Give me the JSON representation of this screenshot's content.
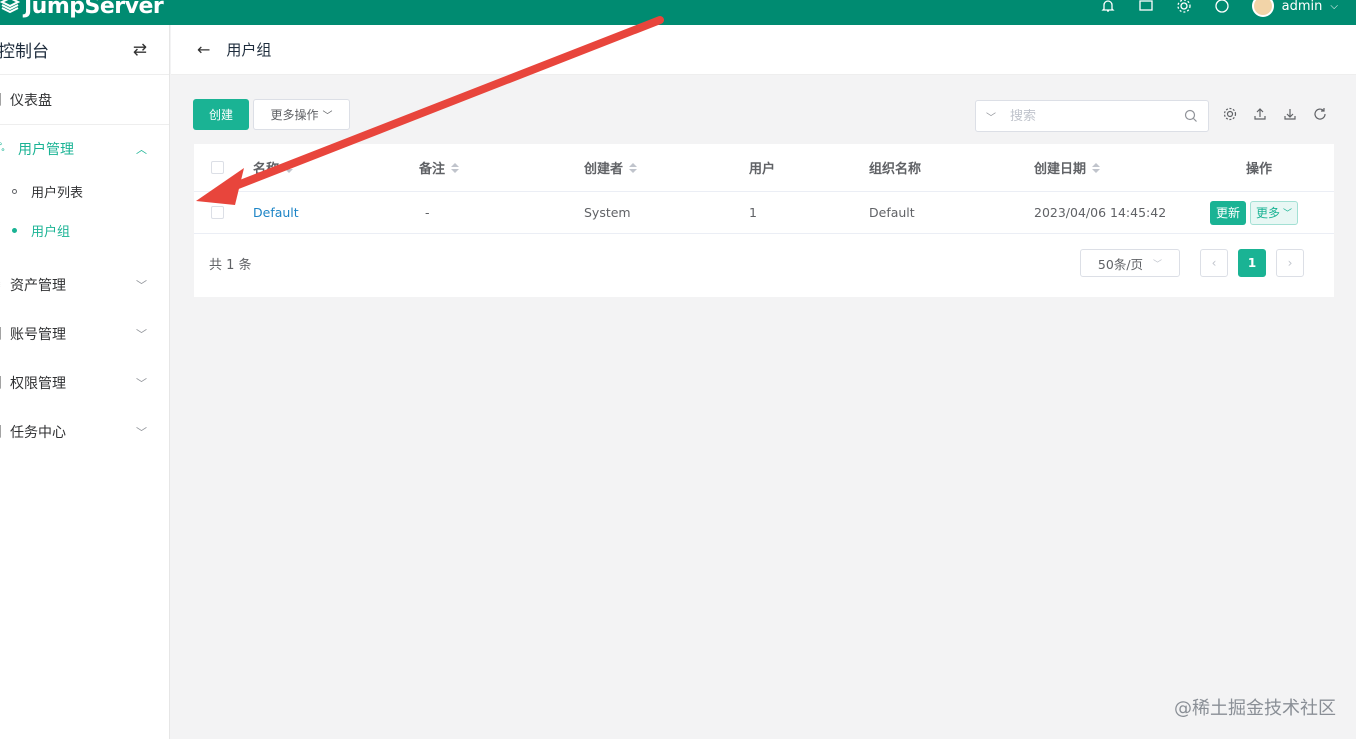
{
  "app": {
    "logo_text": "JumpServer",
    "user": "admin"
  },
  "sidebar": {
    "title": "控制台",
    "items": [
      {
        "label": "仪表盘"
      },
      {
        "label": "用户管理"
      },
      {
        "label": "资产管理"
      },
      {
        "label": "账号管理"
      },
      {
        "label": "权限管理"
      },
      {
        "label": "任务中心"
      }
    ],
    "sub_items": [
      {
        "label": "用户列表"
      },
      {
        "label": "用户组"
      }
    ]
  },
  "header": {
    "title": "用户组"
  },
  "toolbar": {
    "create_label": "创建",
    "more_label": "更多操作",
    "search_placeholder": "搜索"
  },
  "table": {
    "columns": [
      "名称",
      "备注",
      "创建者",
      "用户",
      "组织名称",
      "创建日期",
      "操作"
    ],
    "rows": [
      {
        "name": "Default",
        "comment": "-",
        "creator": "System",
        "users": "1",
        "org": "Default",
        "date": "2023/04/06 14:45:42"
      }
    ],
    "update_label": "更新",
    "more_label": "更多"
  },
  "pagination": {
    "total": "共 1 条",
    "page_size": "50条/页",
    "current": "1"
  },
  "watermark": "@稀土掘金技术社区",
  "colors": {
    "brand": "#008b71",
    "accent": "#1ab394",
    "link": "#1c84c6",
    "annotation": "#e8453c"
  }
}
